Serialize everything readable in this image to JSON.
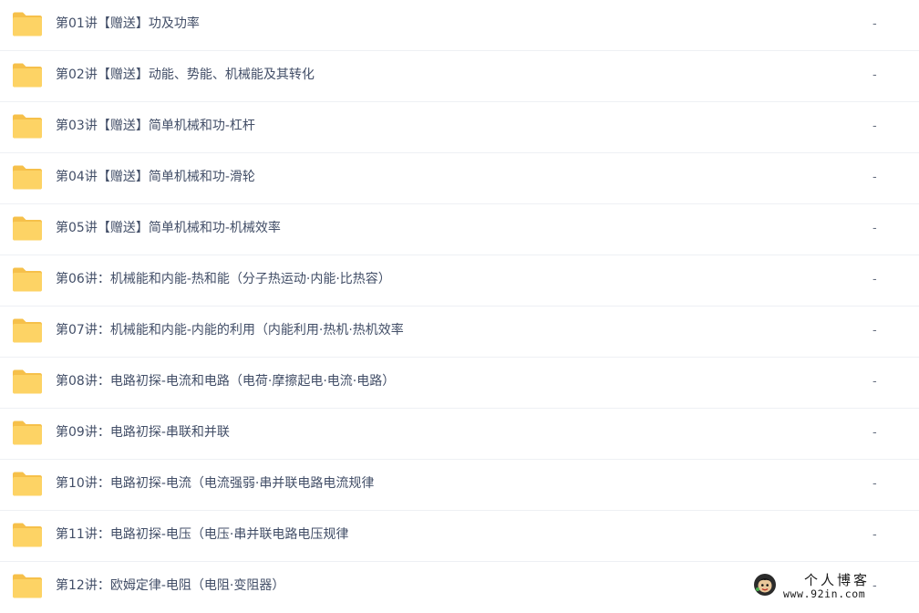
{
  "files": [
    {
      "name": "第01讲【赠送】功及功率",
      "size": "-",
      "icon": "folder-icon"
    },
    {
      "name": "第02讲【赠送】动能、势能、机械能及其转化",
      "size": "-",
      "icon": "folder-icon"
    },
    {
      "name": "第03讲【赠送】简单机械和功-杠杆",
      "size": "-",
      "icon": "folder-icon"
    },
    {
      "name": "第04讲【赠送】简单机械和功-滑轮",
      "size": "-",
      "icon": "folder-icon"
    },
    {
      "name": "第05讲【赠送】简单机械和功-机械效率",
      "size": "-",
      "icon": "folder-icon"
    },
    {
      "name": "第06讲：机械能和内能-热和能（分子热运动·内能·比热容）",
      "size": "-",
      "icon": "folder-icon"
    },
    {
      "name": "第07讲：机械能和内能-内能的利用（内能利用·热机·热机效率",
      "size": "-",
      "icon": "folder-icon"
    },
    {
      "name": "第08讲：电路初探-电流和电路（电荷·摩擦起电·电流·电路）",
      "size": "-",
      "icon": "folder-icon"
    },
    {
      "name": "第09讲：电路初探-串联和并联",
      "size": "-",
      "icon": "folder-icon"
    },
    {
      "name": "第10讲：电路初探-电流（电流强弱·串并联电路电流规律",
      "size": "-",
      "icon": "folder-icon"
    },
    {
      "name": "第11讲：电路初探-电压（电压·串并联电路电压规律",
      "size": "-",
      "icon": "folder-icon"
    },
    {
      "name": "第12讲：欧姆定律-电阻（电阻·变阻器）",
      "size": "-",
      "icon": "folder-icon"
    }
  ],
  "watermark": {
    "title": "个人博客",
    "url": "www.92in.com"
  },
  "colors": {
    "folder_front": "#fdd365",
    "folder_back": "#f6c04a",
    "text": "#424e67",
    "divider": "#eef0f4"
  }
}
